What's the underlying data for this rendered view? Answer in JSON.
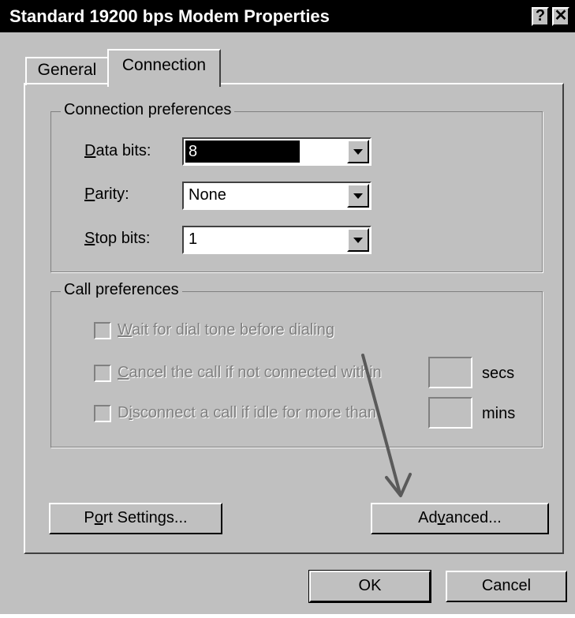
{
  "window": {
    "title": "Standard 19200 bps Modem Properties",
    "help_glyph": "?",
    "close_glyph": "✕"
  },
  "tabs": [
    {
      "label": "General",
      "selected": false
    },
    {
      "label": "Connection",
      "selected": true
    }
  ],
  "connection_preferences": {
    "label": "Connection preferences",
    "data_bits": {
      "label_mnemonic": "D",
      "label_rest": "ata bits:",
      "value": "8"
    },
    "parity": {
      "label_mnemonic": "P",
      "label_rest": "arity:",
      "value": "None"
    },
    "stop_bits": {
      "label_mnemonic": "S",
      "label_rest": "top bits:",
      "value": "1"
    }
  },
  "call_preferences": {
    "label": "Call preferences",
    "wait_dial_tone": {
      "mnemonic": "W",
      "rest": "ait for dial tone before dialing",
      "checked": false,
      "enabled": false
    },
    "cancel_call": {
      "mnemonic": "C",
      "rest": "ancel the call if not connected within",
      "unit": "secs",
      "value": "",
      "checked": false,
      "enabled": false
    },
    "disconnect_idle": {
      "pre": "D",
      "mnemonic": "i",
      "rest": "sconnect a call if idle for more than",
      "unit": "mins",
      "value": "",
      "checked": false,
      "enabled": false
    }
  },
  "buttons": {
    "port_settings": {
      "pre": "P",
      "mnemonic": "o",
      "rest": "rt Settings..."
    },
    "advanced": {
      "pre": "Ad",
      "mnemonic": "v",
      "rest": "anced..."
    },
    "ok": "OK",
    "cancel": "Cancel"
  },
  "annotation": {
    "type": "arrow",
    "points_to": "advanced-button",
    "color": "#5a5a5a"
  }
}
